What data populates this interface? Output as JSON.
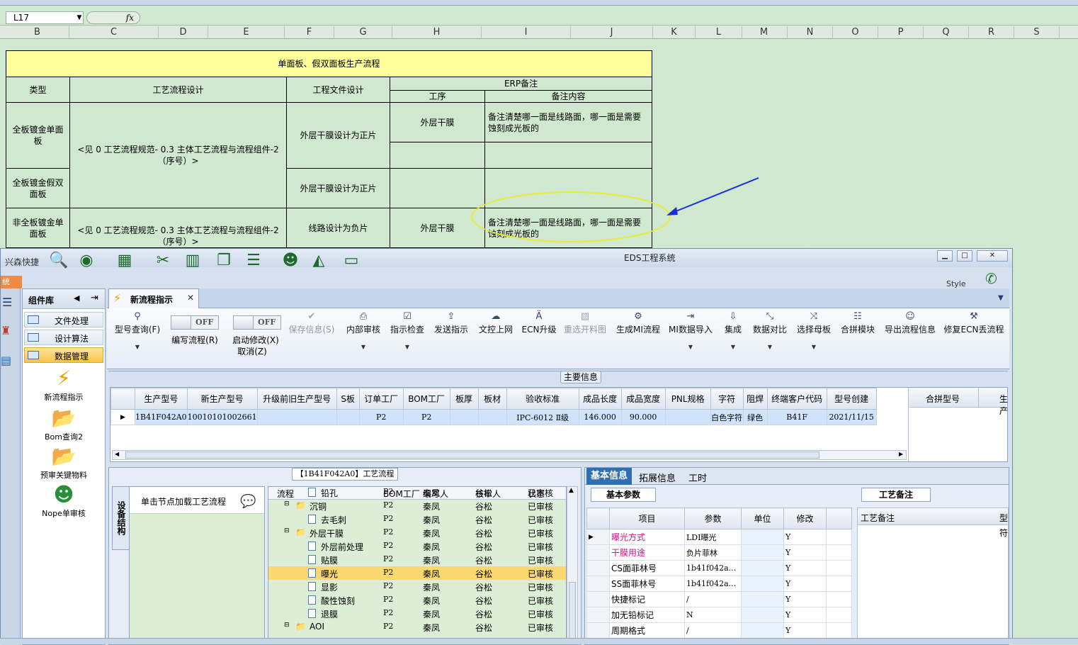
{
  "excel": {
    "cell_ref": "L17",
    "fx": "fx",
    "columns": [
      "B",
      "C",
      "D",
      "E",
      "F",
      "G",
      "H",
      "I",
      "J",
      "K",
      "L",
      "M",
      "N",
      "O",
      "P",
      "Q",
      "R",
      "S"
    ],
    "sheet": {
      "title": "单面板、假双面板生产流程",
      "headers": {
        "type": "类型",
        "process_design": "工艺流程设计",
        "file_design": "工程文件设计",
        "erp_note": "ERP备注",
        "step": "工序",
        "note_content": "备注内容"
      },
      "rows": [
        {
          "type": "全板镀金单面板",
          "process": "<见 0 工艺流程规范- 0.3 主体工艺流程与流程组件-2（序号）>",
          "file": "外层干膜设计为正片",
          "step": "外层干膜",
          "note": "备注清楚哪一面是线路面，哪一面是需要蚀刻成光板的"
        },
        {
          "type": "全板镀金假双面板",
          "file": "外层干膜设计为正片"
        },
        {
          "type": "非全板镀金单面板",
          "process": "<见 0 工艺流程规范- 0.3 主体工艺流程与流程组件-2（序号）>",
          "file": "线路设计为负片",
          "step": "外层干膜",
          "note": "备注清楚哪一面是线路面，哪一面是需要蚀刻成光板的"
        }
      ]
    }
  },
  "eds": {
    "window_title": "EDS工程系统",
    "quicktool_label": "兴森快捷",
    "style_label": "Style",
    "side_tab": "统",
    "component_lib": {
      "title": "组件库",
      "items": [
        "文件处理",
        "设计算法",
        "数据管理"
      ],
      "selected": "数据管理",
      "big_items": [
        "新流程指示",
        "Bom查询2",
        "预审关键物料",
        "Nope单审核"
      ]
    },
    "doc_tab": "新流程指示",
    "toolbar": [
      {
        "label": "型号查询(F)",
        "icon": "search-icon"
      },
      {
        "label": "编写流程(R)",
        "toggle": "OFF"
      },
      {
        "label": "启动修改(X)",
        "label2": "取消(Z)",
        "toggle": "OFF"
      },
      {
        "label": "保存信息(S)",
        "disabled": true
      },
      {
        "label": "内部审核"
      },
      {
        "label": "指示检查"
      },
      {
        "label": "发送指示"
      },
      {
        "label": "文控上网"
      },
      {
        "label": "ECN升级"
      },
      {
        "label": "重选开料图",
        "disabled": true
      },
      {
        "label": "生成MI流程"
      },
      {
        "label": "MI数据导入"
      },
      {
        "label": "集成"
      },
      {
        "label": "数据对比"
      },
      {
        "label": "选择母板"
      },
      {
        "label": "合拼模块"
      },
      {
        "label": "导出流程信息"
      },
      {
        "label": "修复ECN丢流程"
      }
    ],
    "main_info_label": "主要信息",
    "grid": {
      "headers": [
        "生产型号",
        "新生产型号",
        "升级前旧生产型号",
        "S板",
        "订单工厂",
        "BOM工厂",
        "板厚",
        "板材",
        "验收标准",
        "成品长度",
        "成品宽度",
        "PNL规格",
        "字符",
        "阻焊",
        "终端客户代码",
        "型号创建"
      ],
      "row": [
        "1B41F042A0",
        "10010101002661",
        "",
        "",
        "P2",
        "P2",
        "",
        "",
        "IPC-6012 Ⅱ级",
        "146.000",
        "90.000",
        "",
        "白色字符",
        "绿色",
        "B41F",
        "2021/11/15"
      ],
      "right_headers": [
        "合拼型号",
        "生产"
      ]
    },
    "flow": {
      "title": "【1B41F042A0】工艺流程",
      "vertical_tab": "设备结构",
      "node_hint": "单击节点加载工艺流程",
      "columns": [
        "流程",
        "BOM工厂",
        "编写人",
        "核审人",
        "状态"
      ],
      "rows": [
        {
          "name": "铅孔",
          "level": 2,
          "bom": "P2",
          "writer": "秦凤",
          "reviewer": "谷松",
          "status": "已审核"
        },
        {
          "name": "沉铜",
          "level": 1,
          "folder": true,
          "bom": "P2",
          "writer": "秦凤",
          "reviewer": "谷松",
          "status": "已审核"
        },
        {
          "name": "去毛刺",
          "level": 2,
          "bom": "P2",
          "writer": "秦凤",
          "reviewer": "谷松",
          "status": "已审核"
        },
        {
          "name": "外层干膜",
          "level": 1,
          "folder": true,
          "bom": "P2",
          "writer": "秦凤",
          "reviewer": "谷松",
          "status": "已审核"
        },
        {
          "name": "外层前处理",
          "level": 2,
          "bom": "P2",
          "writer": "秦凤",
          "reviewer": "谷松",
          "status": "已审核"
        },
        {
          "name": "贴膜",
          "level": 2,
          "bom": "P2",
          "writer": "秦凤",
          "reviewer": "谷松",
          "status": "已审核"
        },
        {
          "name": "曝光",
          "level": 2,
          "bom": "P2",
          "writer": "秦凤",
          "reviewer": "谷松",
          "status": "已审核",
          "selected": true
        },
        {
          "name": "显影",
          "level": 2,
          "bom": "P2",
          "writer": "秦凤",
          "reviewer": "谷松",
          "status": "已审核"
        },
        {
          "name": "酸性蚀刻",
          "level": 2,
          "bom": "P2",
          "writer": "秦凤",
          "reviewer": "谷松",
          "status": "已审核"
        },
        {
          "name": "退膜",
          "level": 2,
          "bom": "P2",
          "writer": "秦凤",
          "reviewer": "谷松",
          "status": "已审核"
        },
        {
          "name": "AOI",
          "level": 1,
          "folder": true,
          "bom": "P2",
          "writer": "秦凤",
          "reviewer": "谷松",
          "status": "已审核"
        }
      ]
    },
    "info": {
      "tabs": [
        "基本信息",
        "拓展信息",
        "工时"
      ],
      "basic_params_title": "基本参数",
      "param_headers": [
        "项目",
        "参数",
        "单位",
        "修改"
      ],
      "params": [
        {
          "item": "曝光方式",
          "value": "LDI曝光",
          "unit": "",
          "edit": "Y",
          "pink": true
        },
        {
          "item": "干膜用途",
          "value": "负片菲林",
          "unit": "",
          "edit": "Y",
          "pink": true
        },
        {
          "item": "CS面菲林号",
          "value": "1b41f042a...",
          "unit": "",
          "edit": "Y"
        },
        {
          "item": "SS面菲林号",
          "value": "1b41f042a...",
          "unit": "",
          "edit": "Y"
        },
        {
          "item": "快捷标记",
          "value": "/",
          "unit": "",
          "edit": "Y"
        },
        {
          "item": "加无铅标记",
          "value": "N",
          "unit": "",
          "edit": "Y"
        },
        {
          "item": "周期格式",
          "value": "/",
          "unit": "",
          "edit": "Y"
        }
      ],
      "process_note_title": "工艺备注",
      "process_note_col": "工艺备注",
      "process_note_col2": "型",
      "process_note_col3": "符"
    }
  },
  "colors": {
    "excel_bg": "#cfe8cf",
    "title_fill": "#ffff99",
    "highlight": "#fbd96e",
    "ellipse": "#ecec2a",
    "arrow": "#1a2fd6",
    "pink": "#d0118c"
  }
}
